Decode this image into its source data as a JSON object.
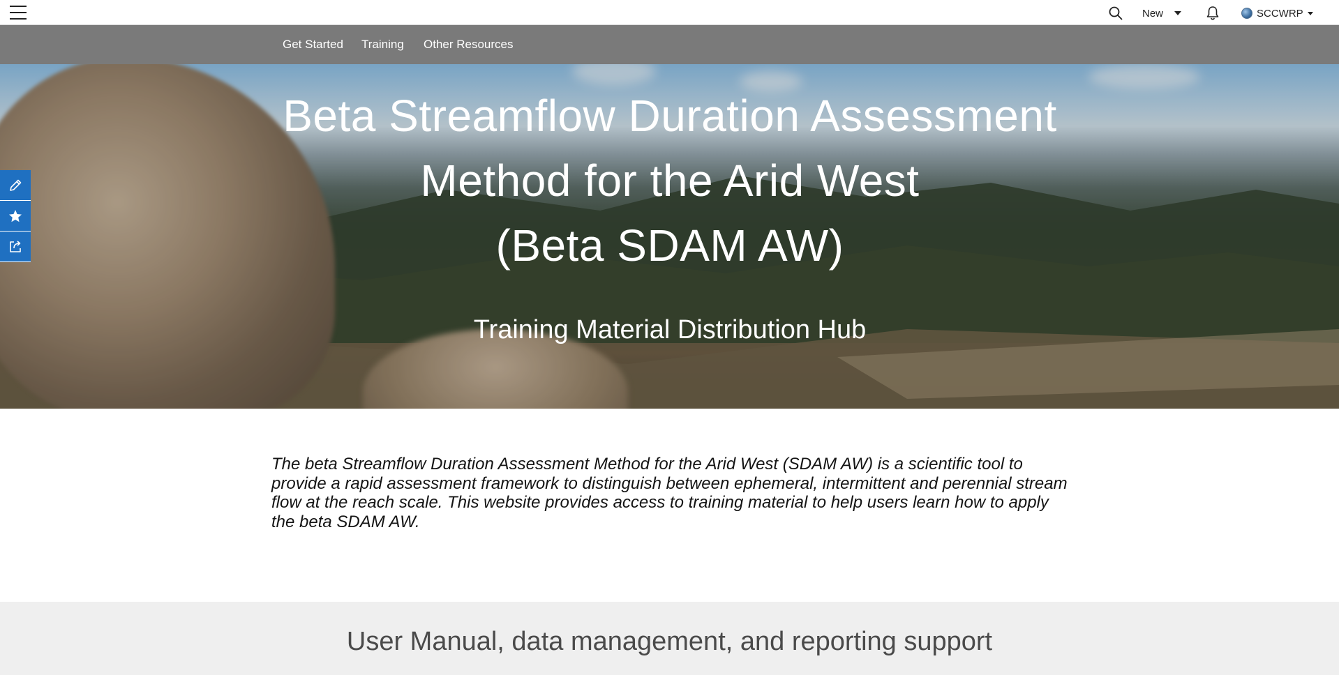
{
  "topbar": {
    "new_label": "New",
    "user_label": "SCCWRP",
    "icons": [
      "menu-icon",
      "search-icon",
      "caret-down-icon",
      "bell-icon",
      "globe-icon"
    ]
  },
  "nav": {
    "items": [
      {
        "label": "Get Started"
      },
      {
        "label": "Training"
      },
      {
        "label": "Other Resources"
      }
    ]
  },
  "hero": {
    "title_line1": "Beta Streamflow Duration Assessment",
    "title_line2": "Method for the Arid West",
    "title_line3": "(Beta SDAM AW)",
    "subtitle": "Training Material Distribution Hub"
  },
  "side_tools": {
    "icons": [
      "pencil-icon",
      "star-icon",
      "share-icon"
    ],
    "accent": "#1f70c1"
  },
  "intro": {
    "text": "The beta Streamflow Duration Assessment Method for the Arid West (SDAM AW) is a scientific tool to provide a rapid assessment framework to distinguish between ephemeral, intermittent and perennial stream flow at the reach scale. This website provides access to training material to help users learn how to apply the beta SDAM AW."
  },
  "section": {
    "title": "User Manual, data management, and reporting support"
  },
  "colors": {
    "navbar": "#7a7a7a",
    "section_bg": "#efefef"
  }
}
